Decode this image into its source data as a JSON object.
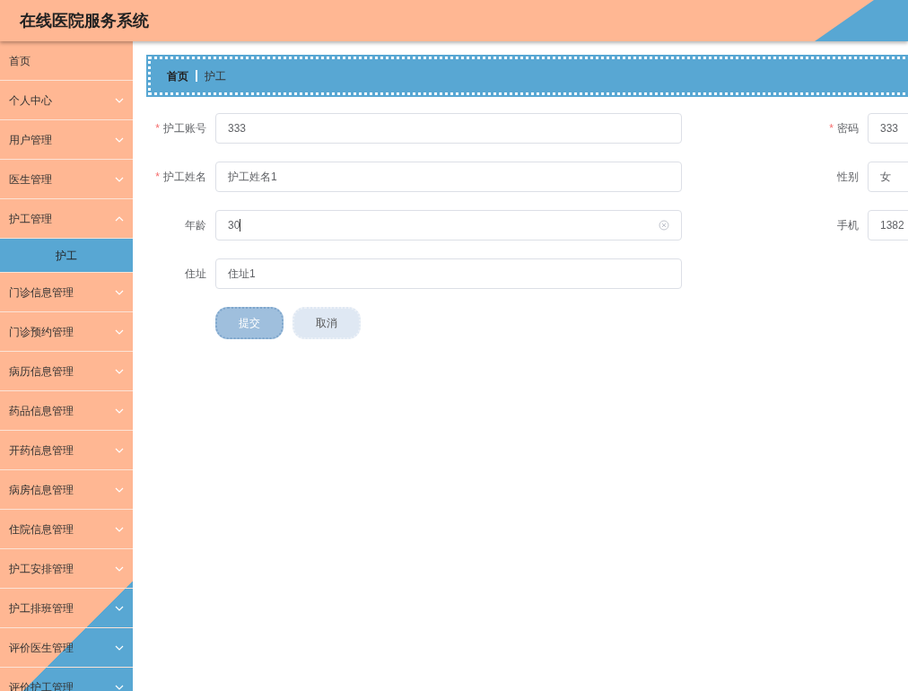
{
  "header": {
    "title": "在线医院服务系统"
  },
  "sidebar": {
    "items": [
      {
        "label": "首页",
        "kind": "link"
      },
      {
        "label": "个人中心",
        "kind": "menu",
        "expanded": false
      },
      {
        "label": "用户管理",
        "kind": "menu",
        "expanded": false
      },
      {
        "label": "医生管理",
        "kind": "menu",
        "expanded": false
      },
      {
        "label": "护工管理",
        "kind": "menu",
        "expanded": true,
        "children": [
          {
            "label": "护工",
            "selected": true
          }
        ]
      },
      {
        "label": "门诊信息管理",
        "kind": "menu",
        "expanded": false
      },
      {
        "label": "门诊预约管理",
        "kind": "menu",
        "expanded": false
      },
      {
        "label": "病历信息管理",
        "kind": "menu",
        "expanded": false
      },
      {
        "label": "药品信息管理",
        "kind": "menu",
        "expanded": false
      },
      {
        "label": "开药信息管理",
        "kind": "menu",
        "expanded": false
      },
      {
        "label": "病房信息管理",
        "kind": "menu",
        "expanded": false
      },
      {
        "label": "住院信息管理",
        "kind": "menu",
        "expanded": false
      },
      {
        "label": "护工安排管理",
        "kind": "menu",
        "expanded": false
      },
      {
        "label": "护工排班管理",
        "kind": "menu",
        "expanded": false
      },
      {
        "label": "评价医生管理",
        "kind": "menu",
        "expanded": false
      },
      {
        "label": "评价护工管理",
        "kind": "menu",
        "expanded": false
      }
    ]
  },
  "breadcrumb": [
    "首页",
    "护工"
  ],
  "form": {
    "rows": [
      {
        "left": {
          "required_mark": "*",
          "label": "护工账号",
          "value": "333"
        },
        "right": {
          "required_mark": "*",
          "label": "密码",
          "value": "333"
        }
      },
      {
        "left": {
          "required_mark": "*",
          "label": "护工姓名",
          "value": "护工姓名1"
        },
        "right": {
          "label": "性别",
          "value": "女"
        }
      },
      {
        "left": {
          "label": "年龄",
          "value": "30",
          "focused": true
        },
        "right": {
          "label": "手机",
          "value": "1382"
        }
      },
      {
        "left": {
          "label": "住址",
          "value": "住址1"
        }
      }
    ],
    "buttons": [
      {
        "label": "提交",
        "kind": "primary"
      },
      {
        "label": "取消",
        "kind": "secondary"
      }
    ]
  }
}
